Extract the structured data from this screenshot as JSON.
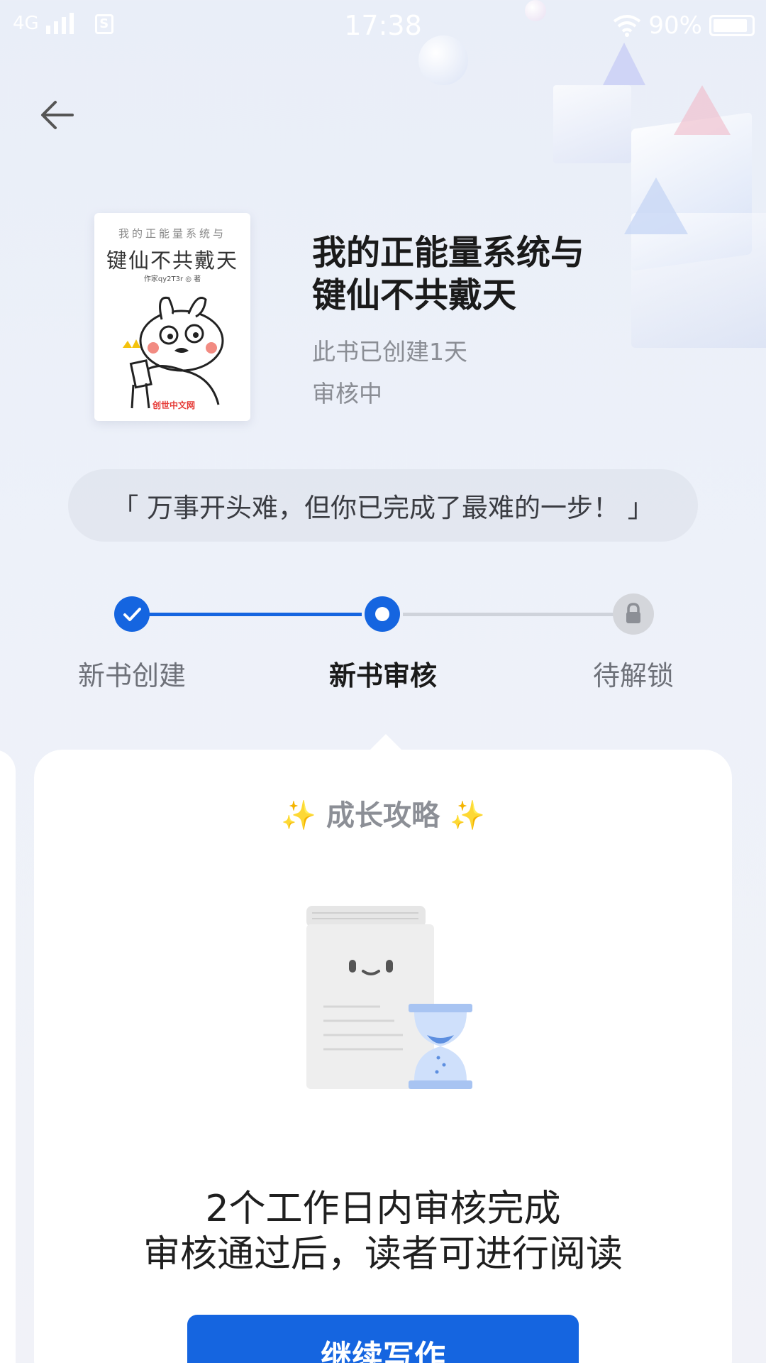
{
  "status_bar": {
    "network": "4G",
    "time": "17:38",
    "battery_percent": "90%",
    "battery_level": 0.9
  },
  "book": {
    "cover": {
      "top_text": "我的正能量系统与",
      "title": "键仙不共戴天",
      "author": "作家qy2T3r ◎ 著",
      "brand": "创世中文网"
    },
    "title_line1": "我的正能量系统与",
    "title_line2": "键仙不共戴天",
    "created": "此书已创建1天",
    "status": "审核中"
  },
  "quote": "「 万事开头难，但你已完成了最难的一步！ 」",
  "steps": [
    {
      "label": "新书创建",
      "state": "done"
    },
    {
      "label": "新书审核",
      "state": "current"
    },
    {
      "label": "待解锁",
      "state": "locked"
    }
  ],
  "card": {
    "heading": "成长攻略",
    "sparkle_left": "✨",
    "sparkle_right": "✨",
    "line1": "2个工作日内审核完成",
    "line2": "审核通过后，读者可进行阅读",
    "button": "继续写作"
  },
  "colors": {
    "primary": "#1565e0",
    "inactive": "#cfd3db"
  }
}
